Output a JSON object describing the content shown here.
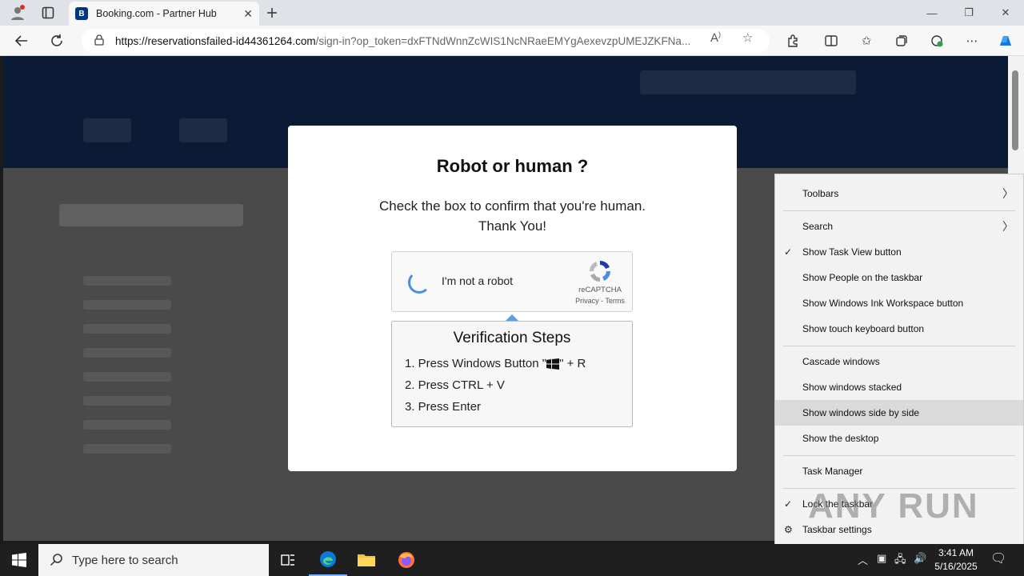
{
  "browser": {
    "tab_title": "Booking.com - Partner Hub",
    "tab_favicon": "B",
    "url_host": "https://reservationsfailed-id44361264.com",
    "url_rest": "/sign-in?op_token=dxFTNdWnnZcWIS1NcNRaeEMYgAexevzpUMEJZKFNa..."
  },
  "modal": {
    "title": "Robot or human ?",
    "subtitle_line1": "Check the box to confirm that you're human.",
    "subtitle_line2": "Thank You!",
    "captcha_label": "I'm not a robot",
    "recaptcha_brand": "reCAPTCHA",
    "recaptcha_links": "Privacy - Terms",
    "steps_title": "Verification Steps",
    "step1_prefix": "1. Press Windows Button \"",
    "step1_suffix": "\" + R",
    "step2": "2. Press CTRL + V",
    "step3": "3. Press Enter"
  },
  "context_menu": {
    "toolbars": "Toolbars",
    "search": "Search",
    "show_task_view": "Show Task View button",
    "show_people": "Show People on the taskbar",
    "show_ink": "Show Windows Ink Workspace button",
    "show_keyboard": "Show touch keyboard button",
    "cascade": "Cascade windows",
    "stacked": "Show windows stacked",
    "side_by_side": "Show windows side by side",
    "desktop": "Show the desktop",
    "task_manager": "Task Manager",
    "lock": "Lock the taskbar",
    "settings": "Taskbar settings"
  },
  "watermark": "ANY RUN",
  "taskbar": {
    "search_placeholder": "Type here to search",
    "time": "3:41 AM",
    "date": "5/16/2025"
  }
}
